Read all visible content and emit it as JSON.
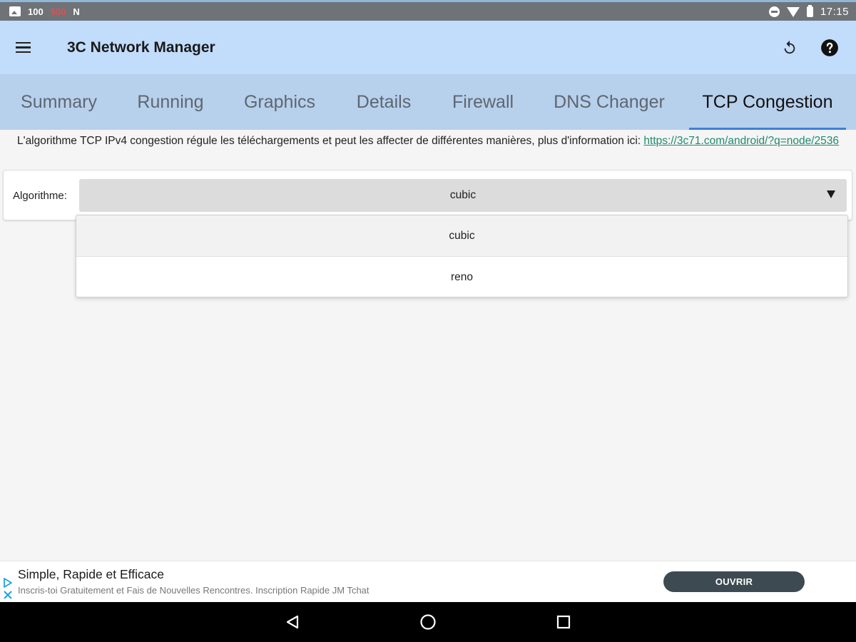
{
  "status_bar": {
    "notif_icons": [
      "image-icon",
      "cpu-100-icon",
      "cpu-500-icon",
      "n-app-icon"
    ],
    "notif_text": [
      "100",
      "500"
    ],
    "time": "17:15"
  },
  "app_bar": {
    "title": "3C Network Manager",
    "actions": [
      "refresh-icon",
      "help-icon"
    ]
  },
  "tabs": [
    {
      "label": "Summary",
      "active": false
    },
    {
      "label": "Running",
      "active": false
    },
    {
      "label": "Graphics",
      "active": false
    },
    {
      "label": "Details",
      "active": false
    },
    {
      "label": "Firewall",
      "active": false
    },
    {
      "label": "DNS Changer",
      "active": false
    },
    {
      "label": "TCP Congestion",
      "active": true
    }
  ],
  "info": {
    "text": "L'algorithme TCP IPv4 congestion régule les téléchargements et peut les affecter de différentes manières, plus d'information ici: ",
    "link": "https://3c71.com/android/?q=node/2536"
  },
  "algorithm": {
    "label": "Algorithme:",
    "selected": "cubic",
    "options": [
      "cubic",
      "reno"
    ]
  },
  "ad": {
    "title": "Simple, Rapide et Efficace",
    "subtitle": "Inscris-toi Gratuitement et Fais de Nouvelles Rencontres. Inscription Rapide JM Tchat",
    "button": "OUVRIR"
  },
  "nav_bar": [
    "back-icon",
    "home-icon",
    "recents-icon"
  ],
  "colors": {
    "app_bar": "#c2dcfb",
    "tab_bar": "#b7d0ec",
    "tab_indicator": "#3f7fd8",
    "link": "#1f8a70",
    "ad_button": "#3d4a52"
  }
}
